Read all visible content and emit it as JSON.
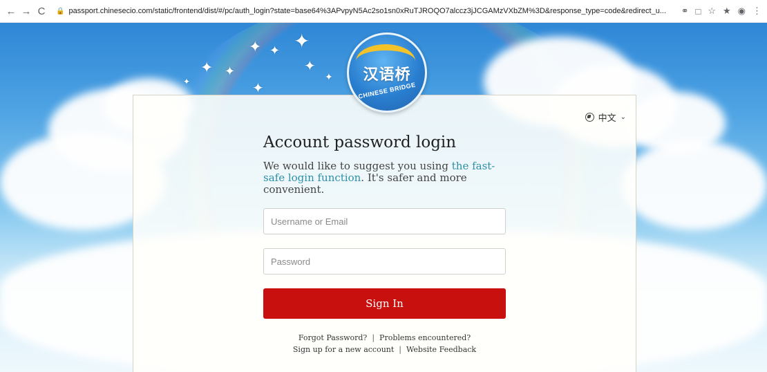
{
  "browser": {
    "url": "passport.chinesecio.com/static/frontend/dist/#/pc/auth_login?state=base64%3APvpyN5Ac2so1sn0xRuTJROQO7alccz3jJCGAMzVXbZM%3D&response_type=code&redirect_u...",
    "back_glyph": "←",
    "forward_glyph": "→",
    "reload_glyph": "C",
    "icons": [
      "back-icon",
      "forward-icon",
      "reload-icon",
      "lock-icon",
      "key-icon",
      "translate-icon",
      "star-icon",
      "extensions-icon",
      "profile-icon",
      "menu-icon"
    ]
  },
  "logo": {
    "main": "汉语桥",
    "sub": "CHINESE BRIDGE"
  },
  "language": {
    "current": "中文"
  },
  "login": {
    "title": "Account password login",
    "suggest_prefix": "We would like to suggest you using ",
    "suggest_link": "the fast-safe login function",
    "suggest_suffix": ". It's safer and more convenient.",
    "username_placeholder": "Username or Email",
    "password_placeholder": "Password",
    "signin_label": "Sign In"
  },
  "links": {
    "forgot": "Forgot Password?",
    "problems": "Problems encountered?",
    "signup": "Sign up for a new account",
    "feedback": "Website Feedback",
    "separator": "|"
  },
  "colors": {
    "signin_button": "#c8100e",
    "link_accent": "#2a8fa8"
  }
}
